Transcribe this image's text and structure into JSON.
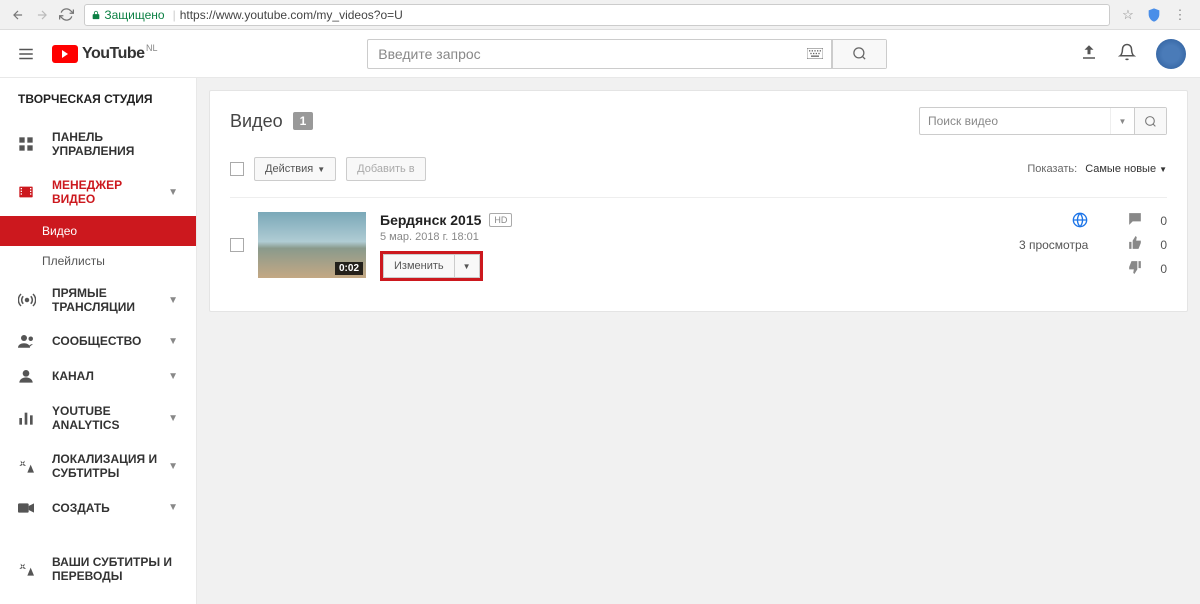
{
  "browser": {
    "secure_label": "Защищено",
    "url": "https://www.youtube.com/my_videos?o=U"
  },
  "header": {
    "logo_text": "YouTube",
    "logo_suffix": "NL",
    "search_placeholder": "Введите запрос"
  },
  "sidebar": {
    "title": "ТВОРЧЕСКАЯ СТУДИЯ",
    "dashboard": "ПАНЕЛЬ УПРАВЛЕНИЯ",
    "video_manager": "МЕНЕДЖЕР ВИДЕО",
    "videos": "Видео",
    "playlists": "Плейлисты",
    "live": "ПРЯМЫЕ ТРАНСЛЯЦИИ",
    "community": "СООБЩЕСТВО",
    "channel": "КАНАЛ",
    "analytics": "YOUTUBE ANALYTICS",
    "localization": "ЛОКАЛИЗАЦИЯ И СУБТИТРЫ",
    "create": "СОЗДАТЬ",
    "your_subtitles": "ВАШИ СУБТИТРЫ И ПЕРЕВОДЫ"
  },
  "main": {
    "title": "Видео",
    "count": "1",
    "search_placeholder": "Поиск видео",
    "actions_btn": "Действия",
    "add_to_btn": "Добавить в",
    "show_label": "Показать:",
    "sort": "Самые новые",
    "video": {
      "title": "Бердянск 2015",
      "badge": "HD",
      "date": "5 мар. 2018 г. 18:01",
      "duration": "0:02",
      "edit": "Изменить",
      "views": "3 просмотра",
      "comments": "0",
      "likes": "0",
      "dislikes": "0"
    }
  }
}
